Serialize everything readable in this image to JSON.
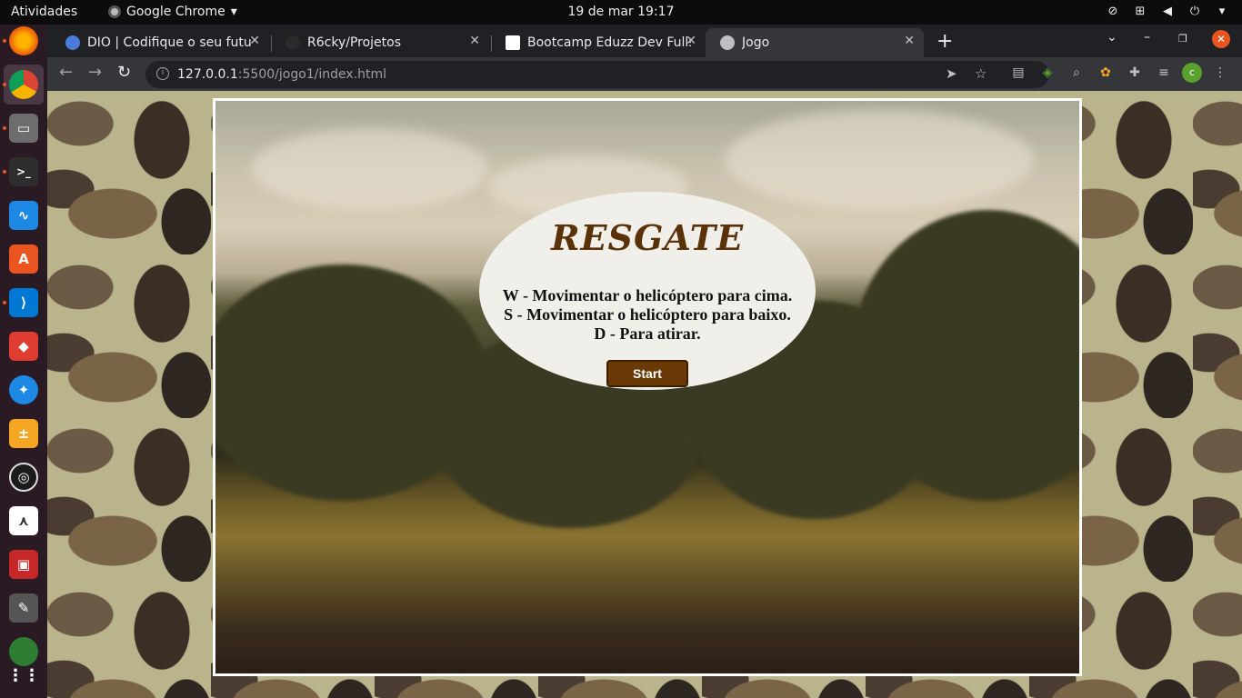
{
  "topbar": {
    "activities": "Atividades",
    "app_name": "Google Chrome",
    "clock": "19 de mar  19:17"
  },
  "tabs": [
    {
      "title": "DIO | Codifique o seu futu",
      "favicon_color": "#4a7bd8"
    },
    {
      "title": "R6cky/Projetos",
      "favicon_color": "#2b2b2b"
    },
    {
      "title": "Bootcamp Eduzz Dev Fullst",
      "favicon_color": "#ffffff"
    },
    {
      "title": "Jogo",
      "favicon_color": "#bdc1c6"
    }
  ],
  "address_bar": {
    "host": "127.0.0.1",
    "rest": ":5500/jogo1/index.html"
  },
  "profile_initial": "c",
  "game": {
    "title": "RESGATE",
    "instructions": [
      "W - Movimentar o helicóptero para cima.",
      "S - Movimentar o helicóptero para baixo.",
      "D - Para atirar."
    ],
    "start_label": "Start"
  },
  "colors": {
    "title_brown": "#5a3208",
    "button_brown": "#6a3a06",
    "oval_bg": "#f1efea",
    "ubuntu_orange": "#e95420"
  }
}
